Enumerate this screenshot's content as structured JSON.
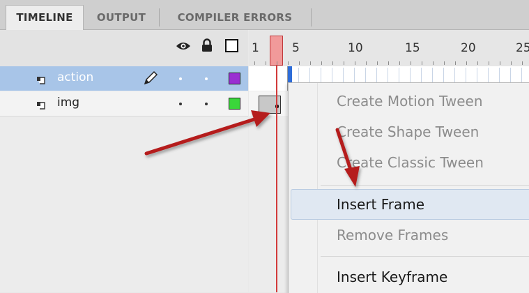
{
  "tabs": [
    {
      "label": "TIMELINE",
      "active": true
    },
    {
      "label": "OUTPUT",
      "active": false
    },
    {
      "label": "COMPILER ERRORS",
      "active": false
    }
  ],
  "layers": [
    {
      "name": "action",
      "selected": true,
      "color": "#9a2fd2"
    },
    {
      "name": "img",
      "selected": false,
      "color": "#3ad63a"
    }
  ],
  "ruler": {
    "labels": [
      "1",
      "5",
      "10",
      "15",
      "20",
      "25"
    ]
  },
  "context_menu": {
    "items": [
      {
        "label": "Create Motion Tween",
        "enabled": false
      },
      {
        "label": "Create Shape Tween",
        "enabled": false
      },
      {
        "label": "Create Classic Tween",
        "enabled": false
      },
      {
        "label": "Insert Frame",
        "enabled": true,
        "highlighted": true
      },
      {
        "label": "Remove Frames",
        "enabled": false
      },
      {
        "label": "Insert Keyframe",
        "enabled": true
      }
    ]
  },
  "icons": [
    "eye-icon",
    "lock-icon",
    "outline-icon",
    "layer-icon",
    "pencil-icon"
  ],
  "colors": {
    "selection": "#a8c5e8",
    "playhead": "#d23a3a",
    "annotation_arrow": "#b51f1f"
  }
}
